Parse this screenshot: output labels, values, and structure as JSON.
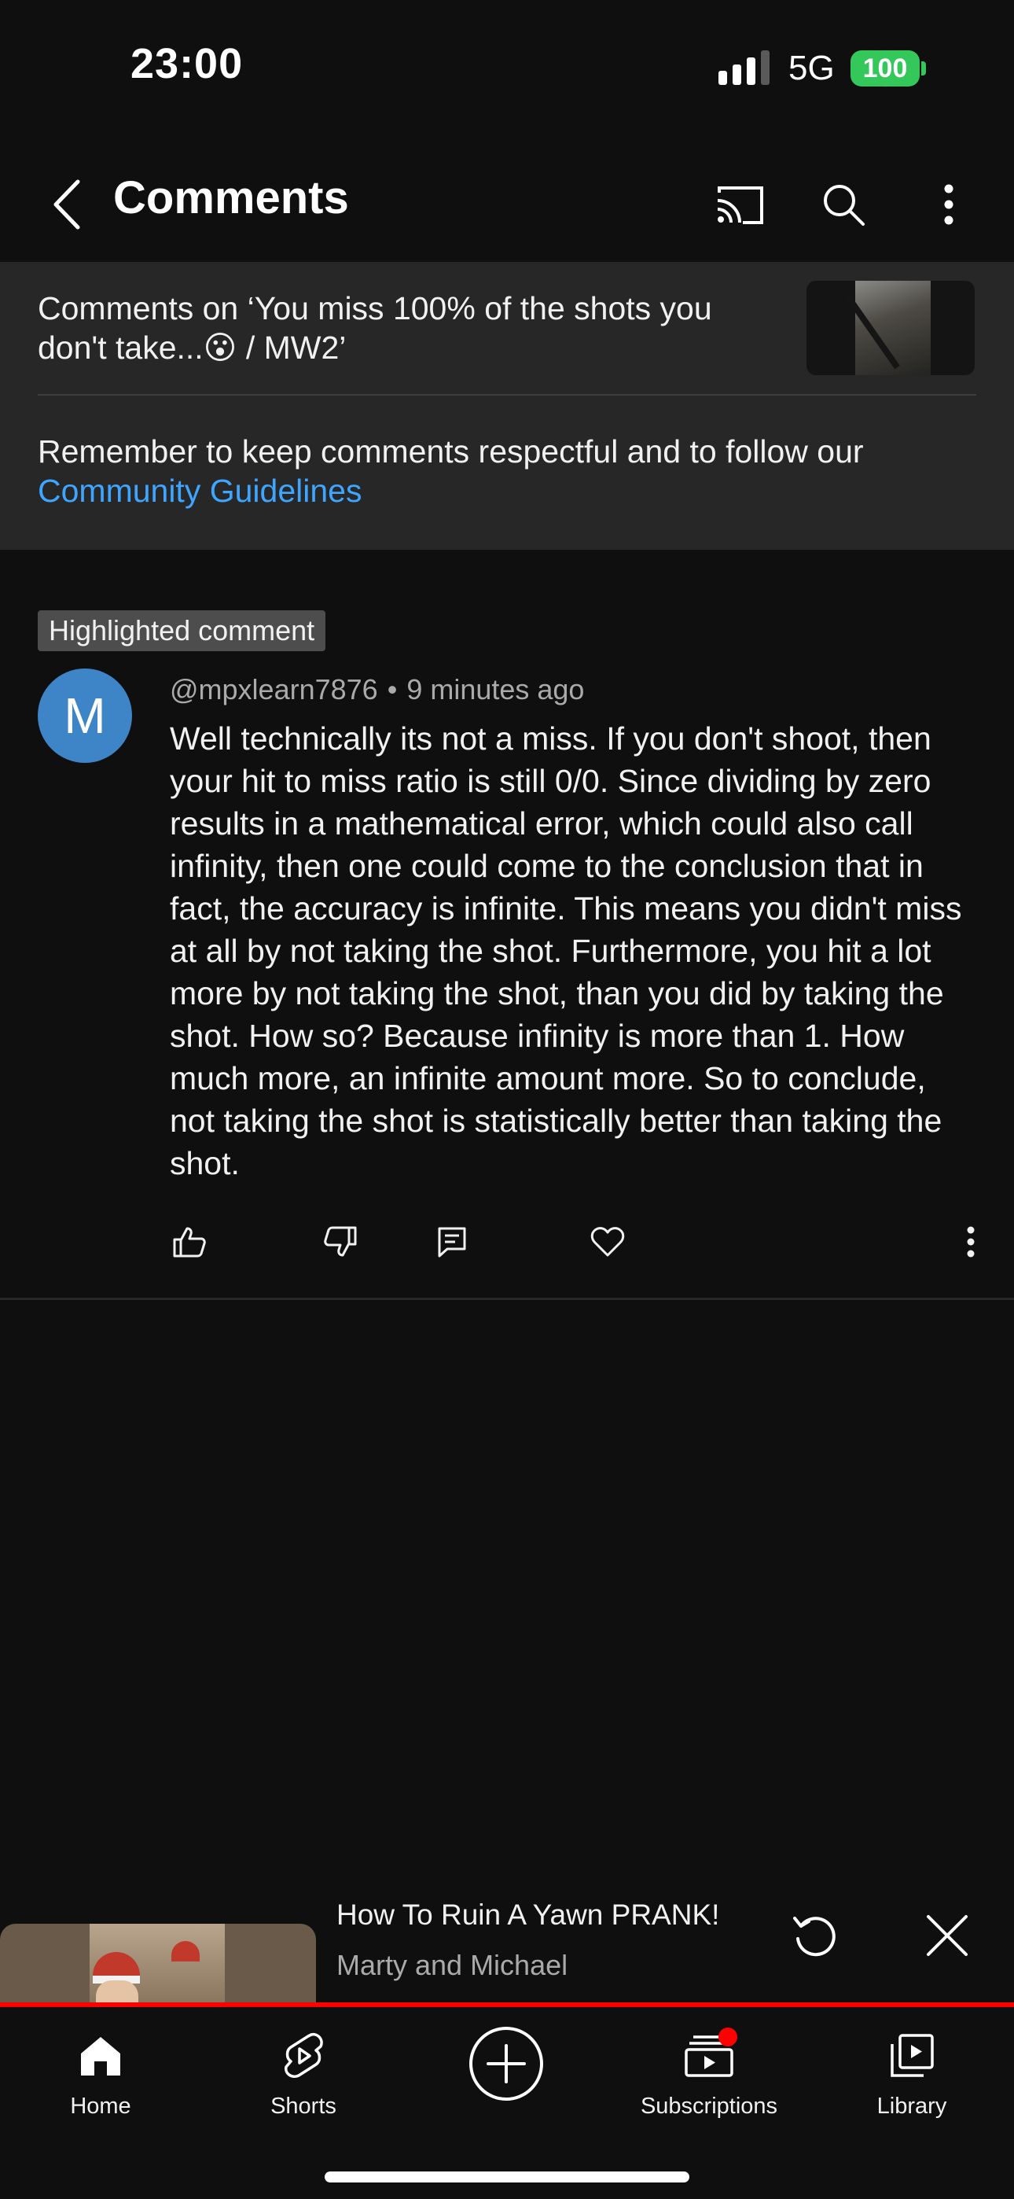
{
  "status_bar": {
    "time": "23:00",
    "network": "5G",
    "battery": "100"
  },
  "header": {
    "title": "Comments",
    "icons": [
      "back-icon",
      "cast-icon",
      "search-icon",
      "more-vert-icon"
    ]
  },
  "info": {
    "video_title": "Comments on ‘You miss 100% of the shots you don't take...😮 / MW2’",
    "guidelines_text": "Remember to keep comments respectful and to follow our",
    "guidelines_link": "Community Guidelines"
  },
  "comment": {
    "badge": "Highlighted comment",
    "avatar_letter": "M",
    "author": "@mpxlearn7876",
    "separator": "•",
    "time": "9 minutes ago",
    "text": "Well technically its not a miss. If you don't shoot, then your hit to miss ratio is still 0/0. Since dividing by zero results in a mathematical error, which could also call infinity, then one could come to the conclusion that in fact, the accuracy is infinite. This means you didn't miss at all by not taking the shot. Furthermore, you hit a lot more by not taking the shot, than you did by taking the shot. How so? Because infinity is more than 1. How much more, an infinite amount more. So to conclude, not taking the shot is statistically better than taking the shot.",
    "actions": [
      "like-icon",
      "dislike-icon",
      "reply-icon",
      "heart-icon",
      "more-vert-icon"
    ]
  },
  "mini_player": {
    "title": "How To Ruin A Yawn PRANK!",
    "channel": "Marty and Michael"
  },
  "colors": {
    "background": "#0f0f0f",
    "panel": "#272727",
    "link": "#3ea6ff",
    "avatar": "#3d85c6",
    "accent_red": "#ff0000",
    "battery": "#34c759"
  },
  "nav": {
    "home": "Home",
    "shorts": "Shorts",
    "subscriptions": "Subscriptions",
    "library": "Library"
  }
}
